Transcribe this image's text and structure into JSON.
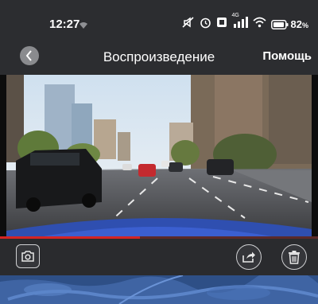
{
  "status_bar": {
    "time": "12:27",
    "battery_percent": "82",
    "battery_unit": "%",
    "network_label": "4G",
    "icons": [
      "mute-icon",
      "alarm-icon",
      "nfc-icon",
      "signal-icon",
      "wifi-icon",
      "battery-icon"
    ]
  },
  "header": {
    "title": "Воспроизведение",
    "help_label": "Помощь"
  },
  "player": {
    "progress": 0.44,
    "accent_color": "#d32424"
  },
  "controls": {
    "icons": [
      "camera-icon",
      "share-icon",
      "trash-icon"
    ]
  },
  "colors": {
    "background": "#2a2b2e",
    "map": "#2e4f86"
  }
}
